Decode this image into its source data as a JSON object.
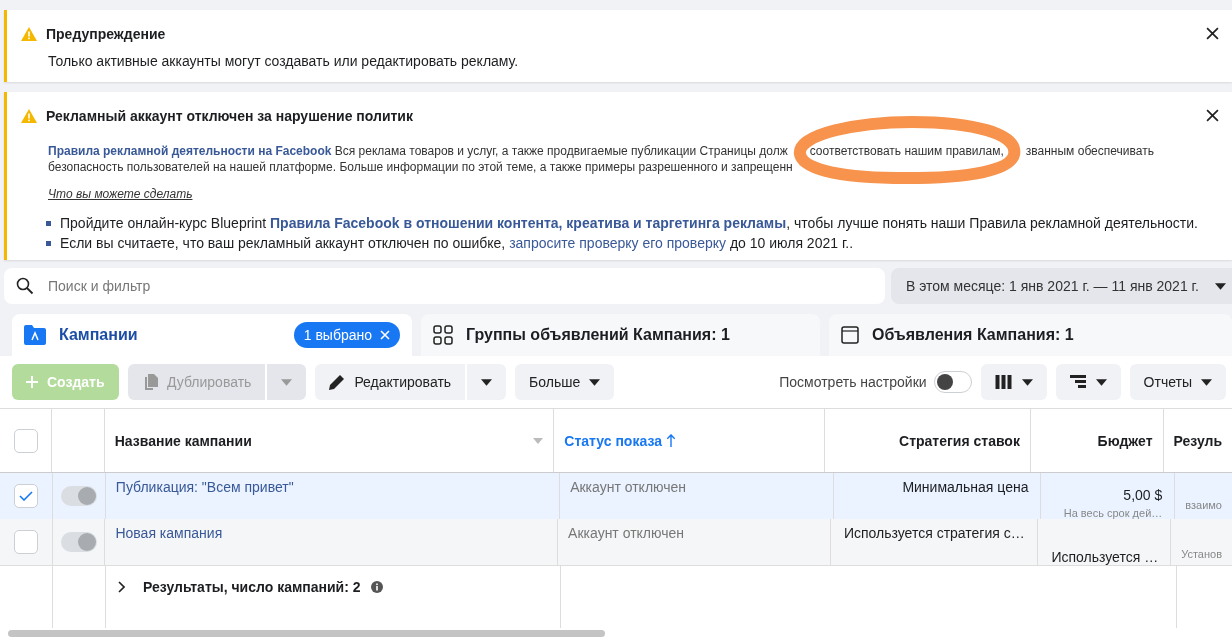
{
  "alerts": [
    {
      "title": "Предупреждение",
      "text": "Только активные аккаунты могут создавать или редактировать рекламу."
    },
    {
      "title": "Рекламный аккаунт отключен за нарушение политик",
      "policy_link": "Правила рекламной деятельности на Facebook",
      "body_line_1": "Вся реклама товаров и услуг, а также продвигаемые публикации Страницы долж",
      "body_circled": "соответствовать нашим правилам,",
      "body_after_circle": "званным обеспечивать",
      "body_line_2": "безопасность пользователей на нашей платформе. Больше информации по этой теме, а также примеры разрешенного и запрещенн",
      "subheading": "Что вы можете сделать",
      "bullets": [
        {
          "before": "Пройдите онлайн-курс Blueprint ",
          "link": "Правила Facebook в отношении контента, креатива и таргетинга рекламы",
          "link_bold": true,
          "after": ", чтобы лучше понять наши Правила рекламной деятельности."
        },
        {
          "before": "Если вы считаете, что ваш рекламный аккаунт отключен по ошибке, ",
          "link": "запросите проверку его проверку",
          "link_bold": false,
          "after": " до 10 июля 2021 г.."
        }
      ]
    }
  ],
  "search": {
    "placeholder": "Поиск и фильтр"
  },
  "date_range": "В этом месяце: 1 янв 2021 г. — 11 янв 2021 г.",
  "tabs": [
    {
      "kind": "campaigns",
      "label": "Кампании",
      "selected": true,
      "badge": "1 выбрано"
    },
    {
      "kind": "adsets",
      "label": "Группы объявлений Кампания: 1",
      "selected": false
    },
    {
      "kind": "ads",
      "label": "Объявления Кампания: 1",
      "selected": false
    }
  ],
  "toolbar": {
    "create": {
      "label": "Создать",
      "disabled": true
    },
    "duplicate": {
      "label": "Дублировать",
      "disabled": true
    },
    "edit": {
      "label": "Редактировать",
      "disabled": false
    },
    "more": "Больше",
    "view_settings": {
      "label": "Посмотреть настройки",
      "on": false
    },
    "reports": "Отчеты"
  },
  "table": {
    "columns": [
      {
        "label": "Название кампании",
        "sorted": false
      },
      {
        "label": "Статус показа",
        "sorted": true
      },
      {
        "label": "Стратегия ставок",
        "sorted": false
      },
      {
        "label": "Бюджет",
        "sorted": false
      },
      {
        "label": "Резуль",
        "sorted": false
      }
    ],
    "all_checked": false,
    "rows": [
      {
        "checked": true,
        "on": true,
        "name": "Публикация: \"Всем привет\"",
        "status": "Аккаунт отключен",
        "strategy": "Минимальная цена",
        "budget": "5,00 $",
        "budget_note": "На весь срок дей…",
        "result_note": "взаимо"
      },
      {
        "checked": false,
        "on": true,
        "name": "Новая кампания",
        "status": "Аккаунт отключен",
        "strategy": "Используется стратегия с…",
        "budget": "Используется …",
        "result_note": "Установ"
      }
    ],
    "summary": "Результаты, число кампаний: 2"
  }
}
